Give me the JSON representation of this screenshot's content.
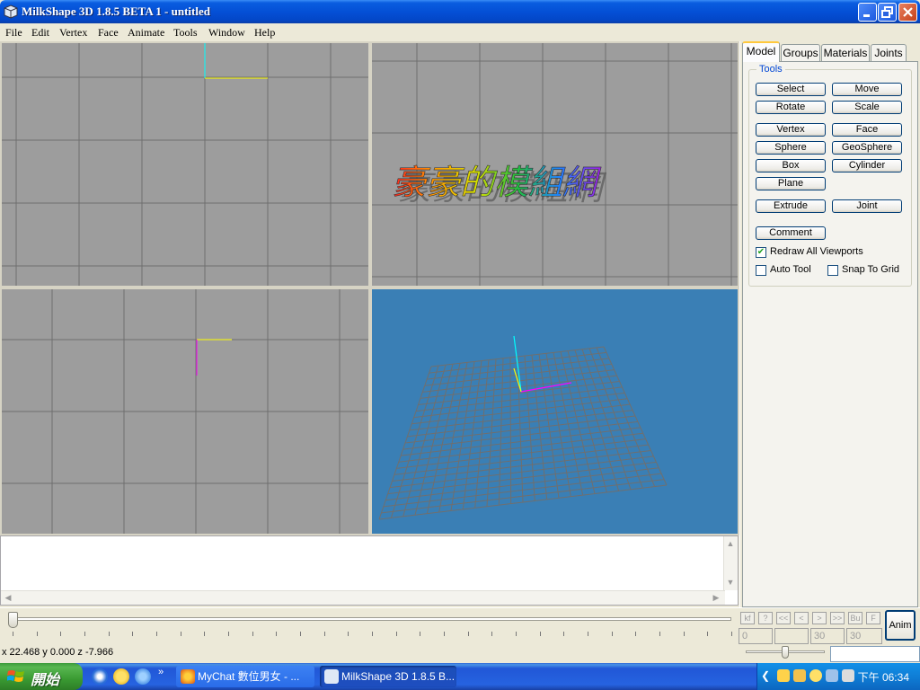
{
  "window": {
    "title": "MilkShape 3D 1.8.5 BETA 1 - untitled"
  },
  "menu": [
    "File",
    "Edit",
    "Vertex",
    "Face",
    "Animate",
    "Tools",
    "Window",
    "Help"
  ],
  "watermark": "豪豪的模組網",
  "tabs": [
    "Model",
    "Groups",
    "Materials",
    "Joints"
  ],
  "tools": {
    "legend": "Tools",
    "buttons": {
      "select": "Select",
      "move": "Move",
      "rotate": "Rotate",
      "scale": "Scale",
      "vertex": "Vertex",
      "face": "Face",
      "sphere": "Sphere",
      "geosphere": "GeoSphere",
      "box": "Box",
      "cylinder": "Cylinder",
      "plane": "Plane",
      "extrude": "Extrude",
      "joint": "Joint",
      "comment": "Comment"
    },
    "checkboxes": {
      "redraw": {
        "label": "Redraw All Viewports",
        "checked": true
      },
      "auto_tool": {
        "label": "Auto Tool",
        "checked": false
      },
      "snap_grid": {
        "label": "Snap To Grid",
        "checked": false
      }
    }
  },
  "animation": {
    "frame_current": "0",
    "frame_total": "30",
    "frame_total2": "30",
    "anim_label": "Anim",
    "controls": [
      "kf",
      "?",
      "<<",
      "<",
      ">",
      ">>",
      "Bu",
      "F"
    ]
  },
  "status": {
    "coords": "x 22.468 y 0.000 z -7.966"
  },
  "taskbar": {
    "start_label": "開始",
    "tasks": [
      "MyChat 數位男女 - ...",
      "MilkShape 3D 1.8.5 B..."
    ],
    "clock": "下午 06:34"
  },
  "colors": {
    "viewport_gray": "#9d9d9d",
    "viewport_3d": "#3a7fb5",
    "grid_line": "#6f6f6f"
  }
}
